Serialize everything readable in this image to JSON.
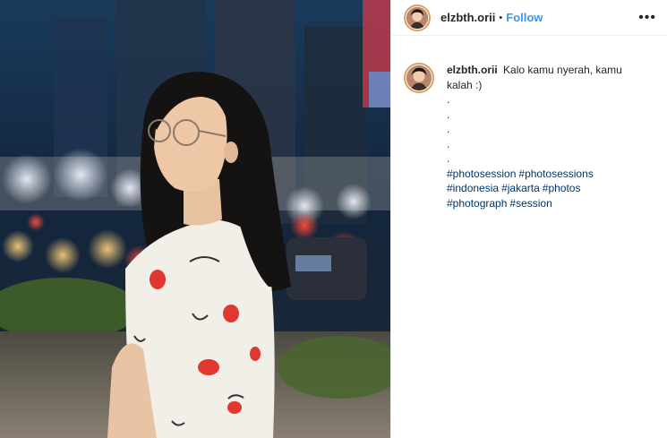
{
  "post": {
    "username": "elzbth.orii",
    "separator": "•",
    "follow_label": "Follow",
    "more_label": "•••"
  },
  "caption": {
    "username": "elzbth.orii",
    "text": "Kalo kamu nyerah, kamu kalah :)",
    "dot_lines": [
      ".",
      ".",
      ".",
      ".",
      "."
    ],
    "hashtags": [
      "#photosession",
      "#photosessions",
      "#indonesia",
      "#jakarta",
      "#photos",
      "#photograph",
      "#session"
    ]
  },
  "colors": {
    "link_blue": "#3897f0",
    "hashtag_blue": "#003569",
    "story_ring": "#d8a066"
  },
  "icons": {
    "more": "more-options-icon"
  }
}
